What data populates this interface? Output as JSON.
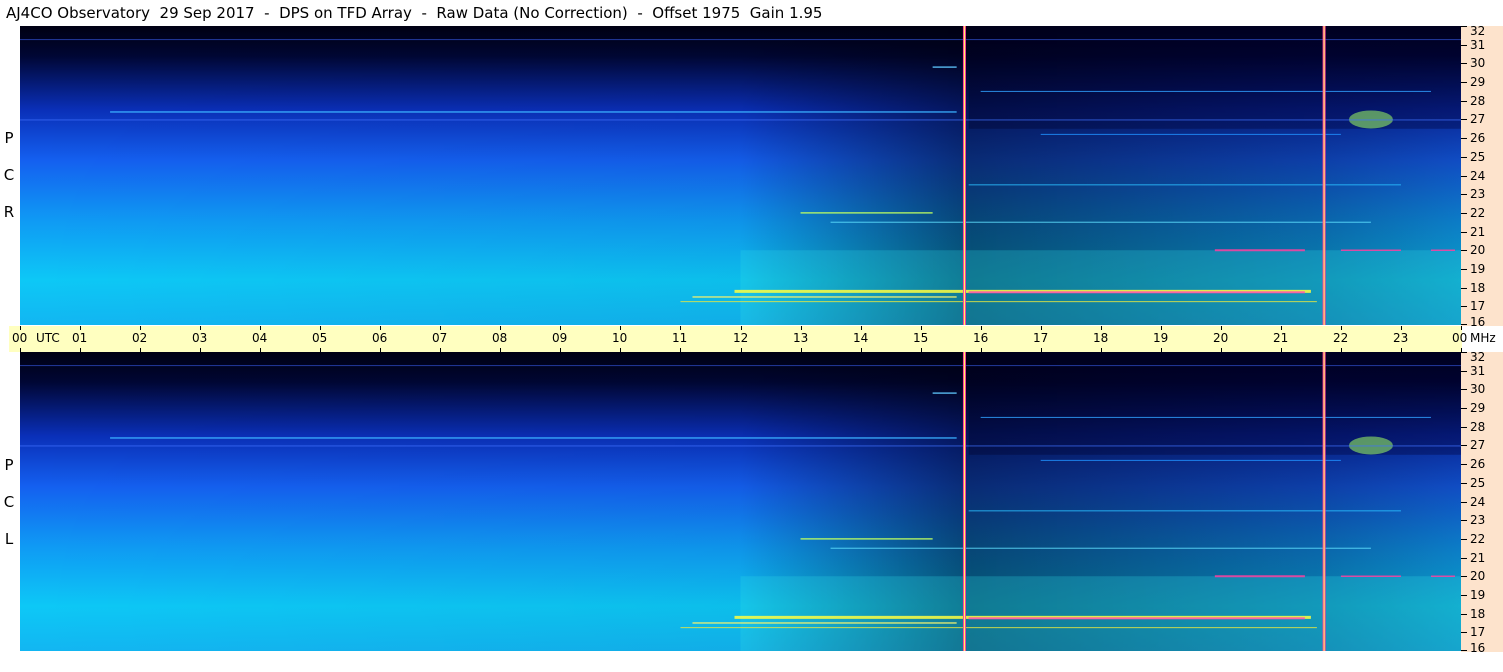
{
  "title": "AJ4CO Observatory  29 Sep 2017  -  DPS on TFD Array  -  Raw Data (No Correction)  -  Offset 1975  Gain 1.95",
  "panels": [
    {
      "letters": [
        "R",
        "C",
        "P"
      ]
    },
    {
      "letters": [
        "L",
        "C",
        "P"
      ]
    }
  ],
  "chart_data": {
    "type": "heatmap",
    "title": "AJ4CO Observatory  29 Sep 2017  -  DPS on TFD Array  -  Raw Data (No Correction)  -  Offset 1975  Gain 1.95",
    "x_ticks": [
      "00",
      "01",
      "02",
      "03",
      "04",
      "05",
      "06",
      "07",
      "08",
      "09",
      "10",
      "11",
      "12",
      "13",
      "14",
      "15",
      "16",
      "17",
      "18",
      "19",
      "20",
      "21",
      "22",
      "23",
      "00"
    ],
    "x_unit": "UTC",
    "xlim": [
      0,
      24
    ],
    "y_ticks": [
      16,
      17,
      18,
      19,
      20,
      21,
      22,
      23,
      24,
      25,
      26,
      27,
      28,
      29,
      30,
      31,
      32
    ],
    "y_unit": "MHz",
    "ylim": [
      16,
      32
    ],
    "series": [
      {
        "name": "RCP"
      },
      {
        "name": "LCP"
      }
    ],
    "vertical_markers_utc": [
      15.73,
      21.72
    ],
    "colors": {
      "low": "#000015",
      "mid": "#1560ff",
      "high": "#10d0f8",
      "hot": "#ffff30",
      "max": "#ff40a0"
    }
  }
}
